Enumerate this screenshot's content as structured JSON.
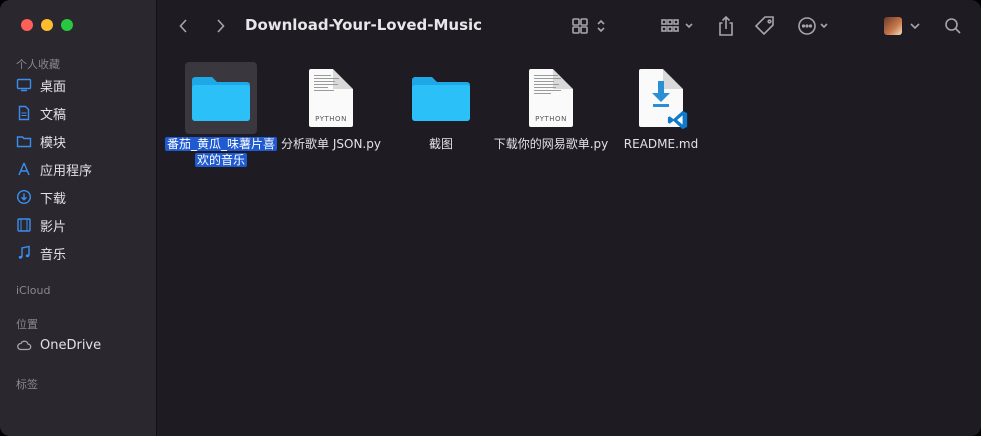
{
  "window": {
    "title": "Download-Your-Loved-Music"
  },
  "sidebar": {
    "sections": {
      "favorites": "个人收藏",
      "icloud": "iCloud",
      "locations": "位置",
      "tags": "标签"
    },
    "favorites": [
      {
        "label": "桌面",
        "icon": "desktop-icon"
      },
      {
        "label": "文稿",
        "icon": "document-icon"
      },
      {
        "label": "模块",
        "icon": "folder-icon"
      },
      {
        "label": "应用程序",
        "icon": "applications-icon"
      },
      {
        "label": "下载",
        "icon": "download-icon"
      },
      {
        "label": "影片",
        "icon": "film-icon"
      },
      {
        "label": "音乐",
        "icon": "music-note-icon"
      }
    ],
    "locations": [
      {
        "label": "OneDrive",
        "icon": "cloud-icon"
      }
    ]
  },
  "files": [
    {
      "name": "番茄_黄瓜_味薯片喜欢的音乐",
      "kind": "folder",
      "selected": true
    },
    {
      "name": "分析歌单 JSON.py",
      "kind": "python"
    },
    {
      "name": "截图",
      "kind": "folder"
    },
    {
      "name": "下载你的网易歌单.py",
      "kind": "python"
    },
    {
      "name": "README.md",
      "kind": "markdown-vscode"
    }
  ],
  "doc_tag": "PYTHON",
  "colors": {
    "accent": "#1f5ad1",
    "folder": "#2bb8f2",
    "close": "#fe5f57",
    "minimize": "#febc2e",
    "zoom": "#28c840"
  }
}
